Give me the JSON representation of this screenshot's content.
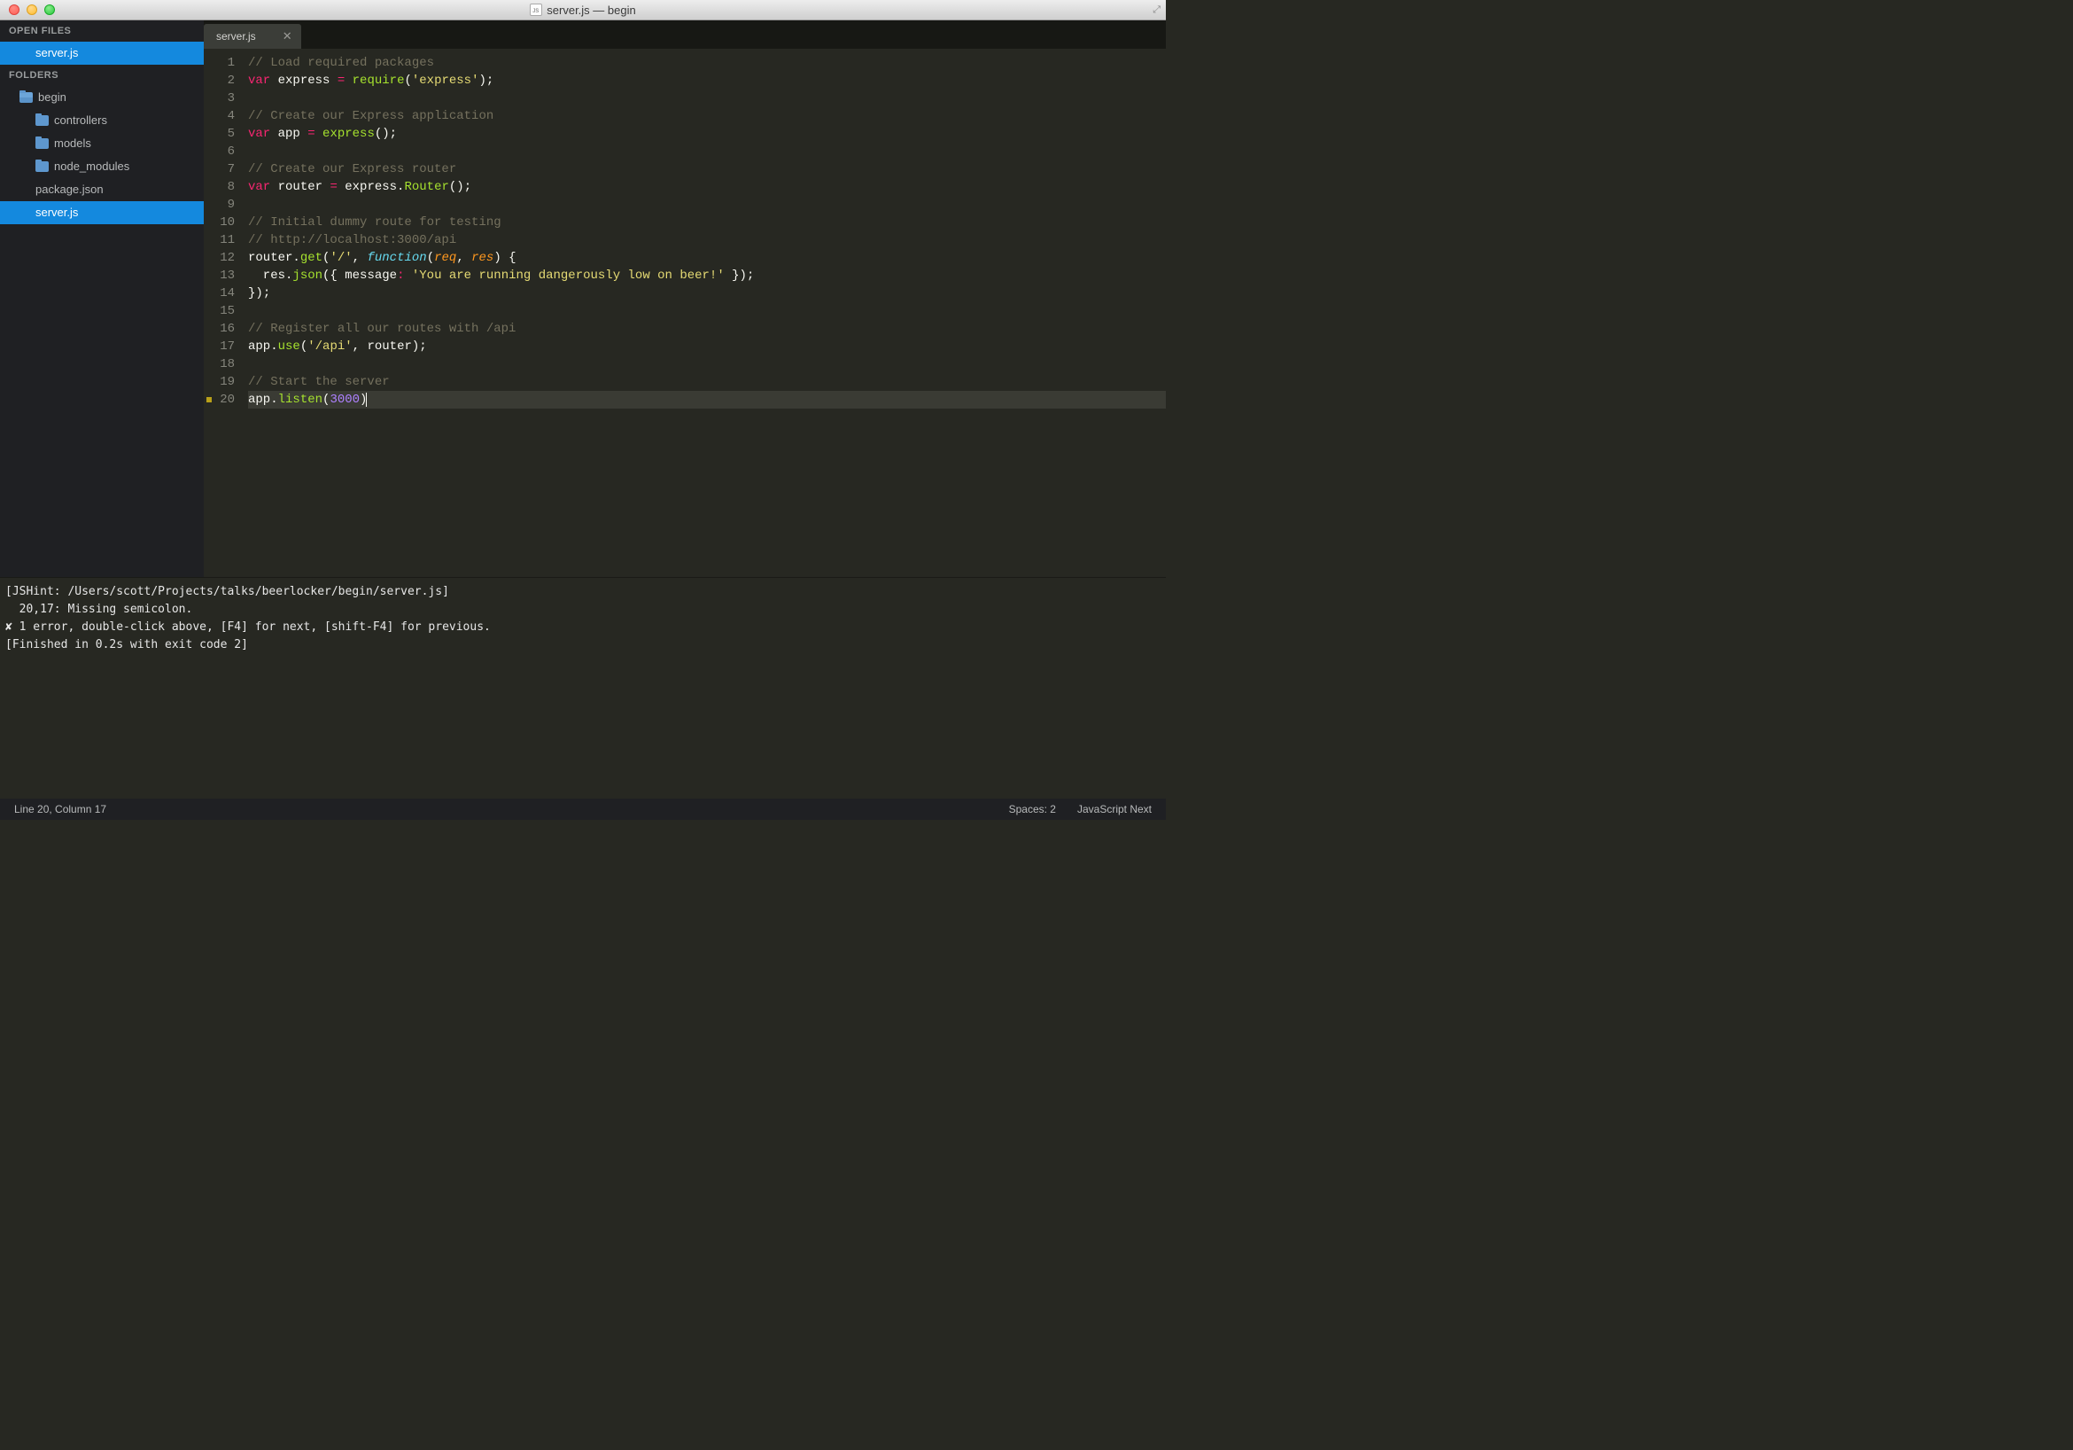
{
  "window": {
    "title": "server.js — begin"
  },
  "sidebar": {
    "open_files_label": "OPEN FILES",
    "open_files": [
      {
        "name": "server.js",
        "active": true
      }
    ],
    "folders_label": "FOLDERS",
    "tree": [
      {
        "name": "begin",
        "type": "folder",
        "level": 1,
        "open": true
      },
      {
        "name": "controllers",
        "type": "folder",
        "level": 2
      },
      {
        "name": "models",
        "type": "folder",
        "level": 2
      },
      {
        "name": "node_modules",
        "type": "folder",
        "level": 2
      },
      {
        "name": "package.json",
        "type": "file",
        "level": 2
      },
      {
        "name": "server.js",
        "type": "file",
        "level": 2,
        "active": true
      }
    ]
  },
  "tabs": [
    {
      "label": "server.js",
      "active": true
    }
  ],
  "code": {
    "lines": [
      {
        "n": 1,
        "tokens": [
          [
            "cm",
            "// Load required packages"
          ]
        ]
      },
      {
        "n": 2,
        "tokens": [
          [
            "st",
            "var"
          ],
          [
            "nm",
            " express "
          ],
          [
            "op",
            "="
          ],
          [
            "nm",
            " "
          ],
          [
            "fn",
            "require"
          ],
          [
            "pn",
            "("
          ],
          [
            "str",
            "'express'"
          ],
          [
            "pn",
            ")"
          ],
          [
            "pn",
            ";"
          ]
        ]
      },
      {
        "n": 3,
        "tokens": []
      },
      {
        "n": 4,
        "tokens": [
          [
            "cm",
            "// Create our Express application"
          ]
        ]
      },
      {
        "n": 5,
        "tokens": [
          [
            "st",
            "var"
          ],
          [
            "nm",
            " app "
          ],
          [
            "op",
            "="
          ],
          [
            "nm",
            " "
          ],
          [
            "fn",
            "express"
          ],
          [
            "pn",
            "()"
          ],
          [
            "pn",
            ";"
          ]
        ]
      },
      {
        "n": 6,
        "tokens": []
      },
      {
        "n": 7,
        "tokens": [
          [
            "cm",
            "// Create our Express router"
          ]
        ]
      },
      {
        "n": 8,
        "tokens": [
          [
            "st",
            "var"
          ],
          [
            "nm",
            " router "
          ],
          [
            "op",
            "="
          ],
          [
            "nm",
            " express."
          ],
          [
            "fn",
            "Router"
          ],
          [
            "pn",
            "()"
          ],
          [
            "pn",
            ";"
          ]
        ]
      },
      {
        "n": 9,
        "tokens": []
      },
      {
        "n": 10,
        "tokens": [
          [
            "cm",
            "// Initial dummy route for testing"
          ]
        ]
      },
      {
        "n": 11,
        "tokens": [
          [
            "cm",
            "// http://localhost:3000/api"
          ]
        ]
      },
      {
        "n": 12,
        "tokens": [
          [
            "nm",
            "router."
          ],
          [
            "fn",
            "get"
          ],
          [
            "pn",
            "("
          ],
          [
            "str",
            "'/'"
          ],
          [
            "pn",
            ", "
          ],
          [
            "kw",
            "function"
          ],
          [
            "pn",
            "("
          ],
          [
            "arg",
            "req"
          ],
          [
            "pn",
            ", "
          ],
          [
            "arg",
            "res"
          ],
          [
            "pn",
            ")"
          ],
          [
            "nm",
            " "
          ],
          [
            "pn",
            "{"
          ]
        ]
      },
      {
        "n": 13,
        "tokens": [
          [
            "nm",
            "  res."
          ],
          [
            "fn",
            "json"
          ],
          [
            "pn",
            "({ "
          ],
          [
            "nm",
            "message"
          ],
          [
            "op",
            ":"
          ],
          [
            "nm",
            " "
          ],
          [
            "str",
            "'You are running dangerously low on beer!'"
          ],
          [
            "pn",
            " })"
          ],
          [
            "pn",
            ";"
          ]
        ]
      },
      {
        "n": 14,
        "tokens": [
          [
            "pn",
            "})"
          ],
          [
            "pn",
            ";"
          ]
        ]
      },
      {
        "n": 15,
        "tokens": []
      },
      {
        "n": 16,
        "tokens": [
          [
            "cm",
            "// Register all our routes with /api"
          ]
        ]
      },
      {
        "n": 17,
        "tokens": [
          [
            "nm",
            "app."
          ],
          [
            "fn",
            "use"
          ],
          [
            "pn",
            "("
          ],
          [
            "str",
            "'/api'"
          ],
          [
            "pn",
            ", router)"
          ],
          [
            "pn",
            ";"
          ]
        ]
      },
      {
        "n": 18,
        "tokens": []
      },
      {
        "n": 19,
        "tokens": [
          [
            "cm",
            "// Start the server"
          ]
        ]
      },
      {
        "n": 20,
        "warn": true,
        "current": true,
        "cursor": true,
        "tokens": [
          [
            "nm",
            "app."
          ],
          [
            "fn",
            "listen"
          ],
          [
            "pn",
            "("
          ],
          [
            "num",
            "3000"
          ],
          [
            "pn",
            ")"
          ]
        ]
      }
    ]
  },
  "output": {
    "lines": [
      "[JSHint: /Users/scott/Projects/talks/beerlocker/begin/server.js]",
      "",
      "  20,17: Missing semicolon.",
      "",
      "✘ 1 error, double-click above, [F4] for next, [shift-F4] for previous.",
      "",
      "[Finished in 0.2s with exit code 2]"
    ]
  },
  "status": {
    "left": "Line 20, Column 17",
    "spaces": "Spaces: 2",
    "syntax": "JavaScript Next"
  }
}
